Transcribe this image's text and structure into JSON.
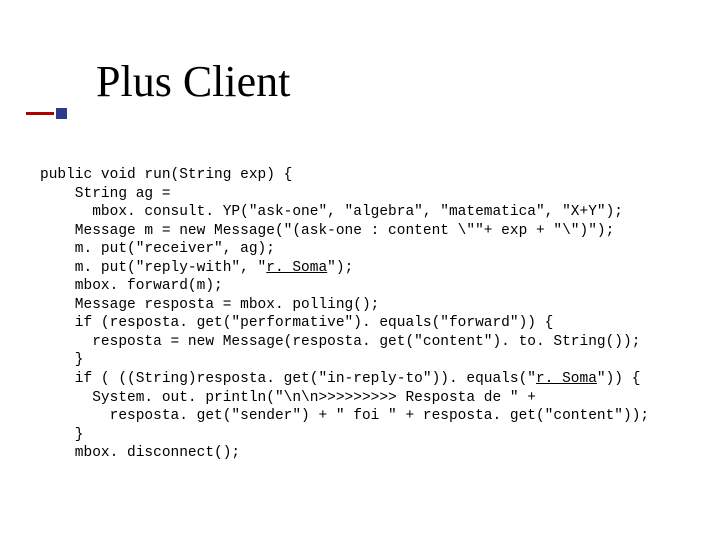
{
  "title": "Plus Client",
  "code": {
    "l1": "public void run(String exp) {",
    "l2": "    String ag =",
    "l3": "      mbox. consult. YP(\"ask-one\", \"algebra\", \"matematica\", \"X+Y\");",
    "l4": "    Message m = new Message(\"(ask-one : content \\\"\"+ exp + \"\\\")\");",
    "l5": "    m. put(\"receiver\", ag);",
    "l6a": "    m. put(\"reply-with\", \"",
    "l6b": "r. Soma",
    "l6c": "\");",
    "l7": "    mbox. forward(m);",
    "l8": "    Message resposta = mbox. polling();",
    "l9": "    if (resposta. get(\"performative\"). equals(\"forward\")) {",
    "l10": "      resposta = new Message(resposta. get(\"content\"). to. String());",
    "l11": "    }",
    "l12a": "    if ( ((String)resposta. get(\"in-reply-to\")). equals(\"",
    "l12b": "r. Soma",
    "l12c": "\")) {",
    "l13": "      System. out. println(\"\\n\\n>>>>>>>>> Resposta de \" +",
    "l14": "        resposta. get(\"sender\") + \" foi \" + resposta. get(\"content\"));",
    "l15": "    }",
    "l16": "    mbox. disconnect();"
  }
}
